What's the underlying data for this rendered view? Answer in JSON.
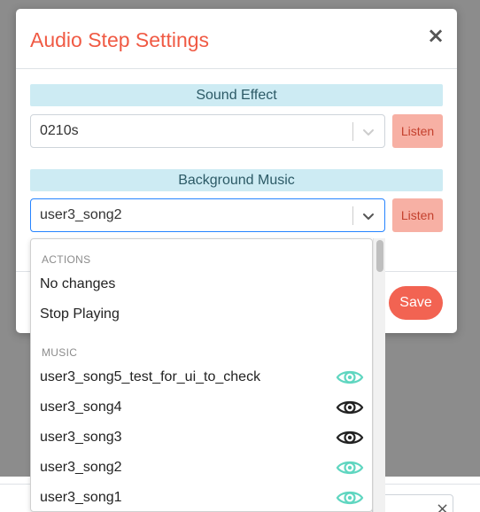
{
  "modal": {
    "title": "Audio Step Settings",
    "close_glyph": "×",
    "save_label": "Save"
  },
  "sound_effect": {
    "label": "Sound Effect",
    "value": "0210s",
    "listen_label": "Listen"
  },
  "background_music": {
    "label": "Background Music",
    "value": "user3_song2",
    "listen_label": "Listen"
  },
  "dropdown": {
    "actions_header": "ACTIONS",
    "actions": [
      {
        "label": "No changes"
      },
      {
        "label": "Stop Playing"
      }
    ],
    "music_header": "MUSIC",
    "music": [
      {
        "label": "user3_song5_test_for_ui_to_check",
        "icon": "eye-icon",
        "icon_color": "#5fd6c0"
      },
      {
        "label": "user3_song4",
        "icon": "eye-icon",
        "icon_color": "#222222"
      },
      {
        "label": "user3_song3",
        "icon": "eye-icon",
        "icon_color": "#222222"
      },
      {
        "label": "user3_song2",
        "icon": "eye-icon",
        "icon_color": "#5fd6c0"
      },
      {
        "label": "user3_song1",
        "icon": "eye-icon",
        "icon_color": "#5fd6c0"
      }
    ]
  },
  "colors": {
    "accent": "#f05a44",
    "section_bg": "#cdebf3",
    "listen_bg": "#f7b0a4",
    "save_bg": "#f26352",
    "focus_border": "#2684ff"
  }
}
